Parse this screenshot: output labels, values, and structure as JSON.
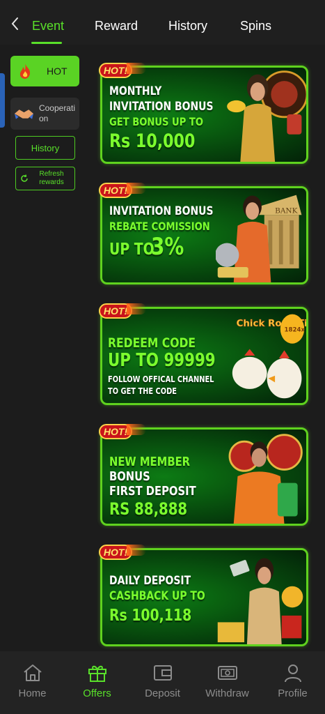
{
  "tabs": [
    {
      "label": "Event",
      "active": true
    },
    {
      "label": "Reward"
    },
    {
      "label": "History"
    },
    {
      "label": "Spins"
    }
  ],
  "sidebar": {
    "hot_label": "HOT",
    "cooperation_label": "Cooperation",
    "history_label": "History",
    "refresh_label": "Refresh rewards"
  },
  "banners": [
    {
      "tag": "HOT!",
      "line1": "MONTHLY",
      "line2": "INVITATION BONUS",
      "line3": "GET BONUS UP TO",
      "line4": "Rs 10,000"
    },
    {
      "tag": "HOT!",
      "line1": "INVITATION BONUS",
      "line2": "REBATE COMISSION",
      "line3": "UP TO",
      "line4": "3%",
      "art_text": "BANK"
    },
    {
      "tag": "HOT!",
      "line1": "REDEEM CODE",
      "line2": "UP TO 99999",
      "line3": "FOLLOW OFFICAL CHANNEL",
      "line4": "TO GET THE CODE",
      "art_text": "Chick Road Time",
      "badge": "1824x"
    },
    {
      "tag": "HOT!",
      "line1": "NEW MEMBER",
      "line2": "BONUS",
      "line3": "FIRST DEPOSIT",
      "line4": "RS 88,888"
    },
    {
      "tag": "HOT!",
      "line1": "DAILY DEPOSIT",
      "line2": "CASHBACK UP TO",
      "line3": "Rs 100,118"
    }
  ],
  "nav": [
    {
      "label": "Home",
      "icon": "home-icon"
    },
    {
      "label": "Offers",
      "icon": "gift-icon",
      "active": true
    },
    {
      "label": "Deposit",
      "icon": "wallet-icon"
    },
    {
      "label": "Withdraw",
      "icon": "cash-icon"
    },
    {
      "label": "Profile",
      "icon": "person-icon"
    }
  ],
  "colors": {
    "accent": "#59e02a",
    "background": "#1c1c1c",
    "banner_border": "#5fd21e"
  }
}
